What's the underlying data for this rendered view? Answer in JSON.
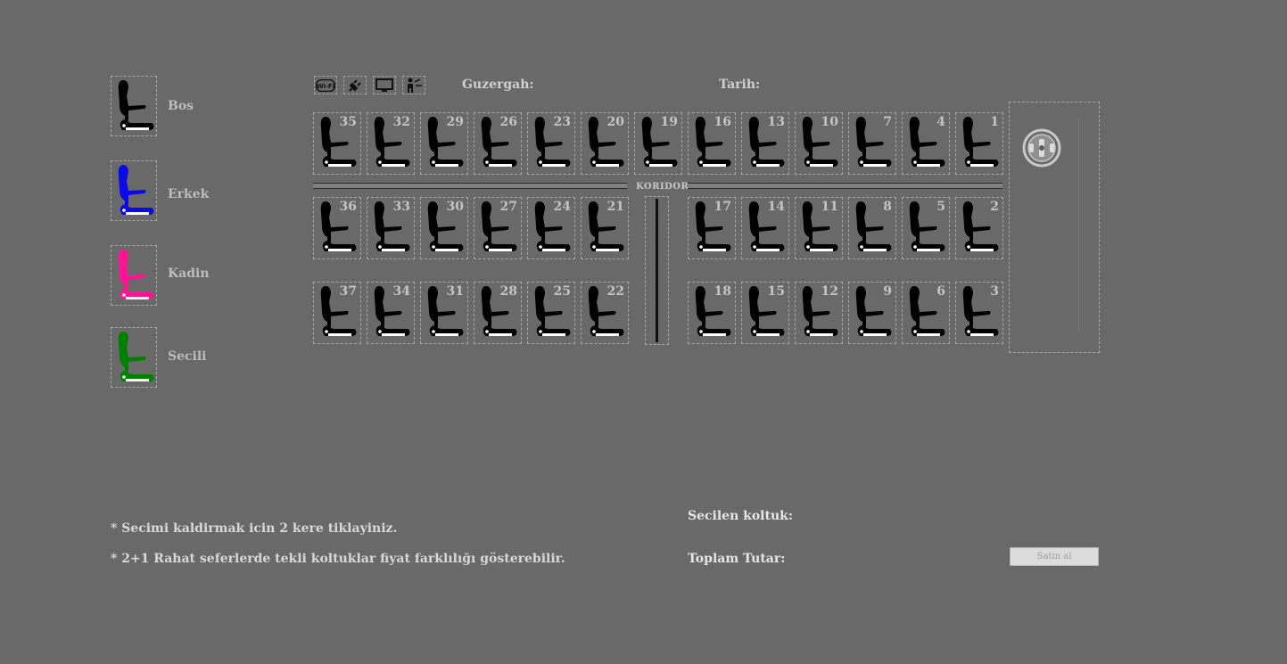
{
  "legend": [
    {
      "label": "Bos",
      "color": "#000000"
    },
    {
      "label": "Erkek",
      "color": "#0a0ae6"
    },
    {
      "label": "Kadin",
      "color": "#ff1493"
    },
    {
      "label": "Secili",
      "color": "#008000"
    }
  ],
  "amenities": [
    "wifi-icon",
    "power-plug-icon",
    "tv-icon",
    "service-icon"
  ],
  "header": {
    "route_label": "Guzergah:",
    "date_label": "Tarih:"
  },
  "aisle_label": "KORIDOR",
  "seats": {
    "row_top": [
      "35",
      "32",
      "29",
      "26",
      "23",
      "20",
      "19",
      "16",
      "13",
      "10",
      "7",
      "4",
      "1"
    ],
    "row_mid_left": [
      "36",
      "33",
      "30",
      "27",
      "24",
      "21"
    ],
    "row_mid_right": [
      "17",
      "14",
      "11",
      "8",
      "5",
      "2"
    ],
    "row_bottom_left": [
      "37",
      "34",
      "31",
      "28",
      "25",
      "22"
    ],
    "row_bottom_right": [
      "18",
      "15",
      "12",
      "9",
      "6",
      "3"
    ],
    "status_color": "#000000"
  },
  "notes": [
    "* Secimi kaldirmak icin 2 kere tiklayiniz.",
    "* 2+1 Rahat seferlerde tekli koltuklar fiyat farklılığı gösterebilir."
  ],
  "summary": {
    "selected_label": "Secilen koltuk:",
    "total_label": "Toplam Tutar:",
    "buy_label": "Satin al"
  }
}
